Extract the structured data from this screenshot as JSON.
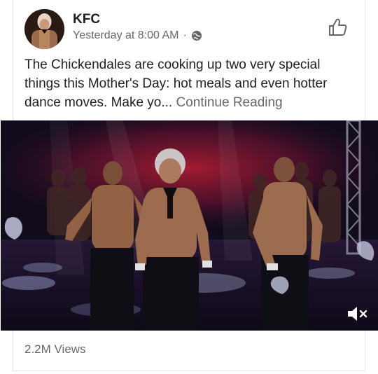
{
  "post": {
    "page_name": "KFC",
    "timestamp": "Yesterday at 8:00 AM",
    "separator": "·",
    "audience_icon": "globe-icon",
    "text": "The Chickendales are cooking up two very special things this Mother's Day: hot meals and even hotter dance moves. Make yo...",
    "continue_label": "Continue Reading",
    "views": "2.2M Views",
    "like_icon": "thumbs-up-icon",
    "video_icon": "mute-icon"
  },
  "colors": {
    "text_primary": "#1c1e21",
    "text_secondary": "#65676b",
    "divider": "#e4e6eb"
  }
}
